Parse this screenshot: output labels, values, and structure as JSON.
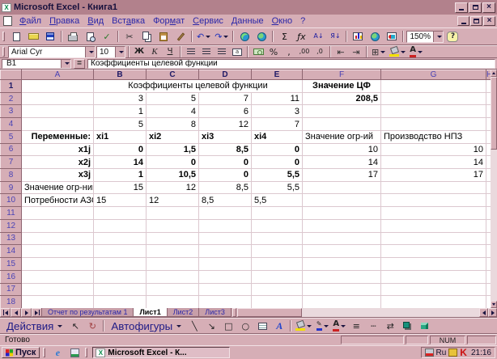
{
  "window": {
    "title": "Microsoft Excel - Книга1",
    "excel_icon_glyph": "X"
  },
  "menu": {
    "items": [
      {
        "name": "file",
        "label": "Файл",
        "u": 0
      },
      {
        "name": "edit",
        "label": "Правка",
        "u": 0
      },
      {
        "name": "view",
        "label": "Вид",
        "u": 0
      },
      {
        "name": "insert",
        "label": "Вставка",
        "u": 3
      },
      {
        "name": "format",
        "label": "Формат",
        "u": 3
      },
      {
        "name": "tools",
        "label": "Сервис",
        "u": 0
      },
      {
        "name": "data",
        "label": "Данные",
        "u": 0
      },
      {
        "name": "window",
        "label": "Окно",
        "u": 0
      },
      {
        "name": "help",
        "label": "?",
        "u": -1
      }
    ]
  },
  "standard_toolbar": {
    "items": [
      {
        "type": "grip"
      },
      {
        "name": "new-document-button",
        "icon": "ic-page"
      },
      {
        "name": "open-button",
        "icon": "ic-folder"
      },
      {
        "name": "save-button",
        "icon": "ic-save"
      },
      {
        "type": "sep"
      },
      {
        "name": "print-button",
        "icon": "ic-printer"
      },
      {
        "name": "print-preview-button",
        "icon": "ic-preview"
      },
      {
        "name": "spelling-button",
        "glyph": "✓",
        "color": "#2a7a2a"
      },
      {
        "type": "sep"
      },
      {
        "name": "cut-button",
        "glyph": "✂",
        "color": "#333333"
      },
      {
        "name": "copy-button",
        "icon": "ic-copy"
      },
      {
        "name": "paste-button",
        "icon": "ic-paste"
      },
      {
        "name": "format-painter-button",
        "icon": "ic-brush"
      },
      {
        "type": "sep"
      },
      {
        "name": "undo-button",
        "glyph": "↶",
        "color": "#2233bb",
        "dropdown": true
      },
      {
        "name": "redo-button",
        "glyph": "↷",
        "color": "#2233bb",
        "dropdown": true
      },
      {
        "type": "sep"
      },
      {
        "name": "insert-hyperlink-button",
        "icon": "ic-globe"
      },
      {
        "name": "web-toolbar-button",
        "icon": "ic-map"
      },
      {
        "type": "sep"
      },
      {
        "name": "autosum-button",
        "glyph": "Σ",
        "color": "#111111"
      },
      {
        "name": "paste-function-button",
        "glyph": "ƒx",
        "cls": "it",
        "color": "#111111"
      },
      {
        "name": "sort-ascending-button",
        "glyph": "А↓",
        "cls": "small",
        "color": "#1a1aa0"
      },
      {
        "name": "sort-descending-button",
        "glyph": "Я↓",
        "cls": "small",
        "color": "#1a1aa0"
      },
      {
        "type": "sep"
      },
      {
        "name": "chart-wizard-button",
        "icon": "ic-chart"
      },
      {
        "name": "map-button",
        "icon": "ic-map"
      },
      {
        "name": "drawing-button",
        "icon": "ic-drawing"
      },
      {
        "type": "sep"
      },
      {
        "type": "combo",
        "name": "zoom-combo",
        "value": "150%",
        "cls": "combo-zoom"
      },
      {
        "name": "help-button",
        "glyph": "?",
        "cls": "help"
      }
    ]
  },
  "formatting_toolbar": {
    "items": [
      {
        "type": "grip"
      },
      {
        "type": "combo",
        "name": "font-name-combo",
        "value": "Arial Cyr",
        "cls": "combo-font"
      },
      {
        "type": "combo",
        "name": "font-size-combo",
        "value": "10",
        "cls": "combo-size"
      },
      {
        "type": "sep"
      },
      {
        "name": "bold-button",
        "glyph": "Ж",
        "cls": "b"
      },
      {
        "name": "italic-button",
        "glyph": "К",
        "cls": "i"
      },
      {
        "name": "underline-button",
        "glyph": "Ч",
        "cls": "u"
      },
      {
        "type": "sep"
      },
      {
        "name": "align-left-button",
        "icon": "ic-align"
      },
      {
        "name": "align-center-button",
        "icon": "ic-align"
      },
      {
        "name": "align-right-button",
        "icon": "ic-align"
      },
      {
        "name": "merge-center-button",
        "glyph": "a",
        "cls": "ic-merge"
      },
      {
        "type": "sep"
      },
      {
        "name": "currency-style-button",
        "icon": "ic-money"
      },
      {
        "name": "percent-style-button",
        "glyph": "%"
      },
      {
        "name": "comma-style-button",
        "glyph": ","
      },
      {
        "name": "increase-decimal-button",
        "glyph": ",00",
        "cls": "small"
      },
      {
        "name": "decrease-decimal-button",
        "glyph": ",0",
        "cls": "small"
      },
      {
        "type": "sep"
      },
      {
        "name": "decrease-indent-button",
        "glyph": "⇤",
        "color": "#333333"
      },
      {
        "name": "increase-indent-button",
        "glyph": "⇥",
        "color": "#333333"
      },
      {
        "type": "sep"
      },
      {
        "name": "borders-button",
        "glyph": "⊞",
        "color": "#333333",
        "dropdown": true
      },
      {
        "name": "fill-color-button",
        "icon": "ic-bucket",
        "bar": "#f2e000",
        "dropdown": true
      },
      {
        "name": "font-color-button",
        "glyph": "А",
        "cls": "b",
        "bar": "#cc2222",
        "dropdown": true
      }
    ]
  },
  "formula_bar": {
    "cell_ref": "B1",
    "equals_label": "=",
    "formula": "Коэффициенты целевой функции"
  },
  "sheet": {
    "columns": [
      "A",
      "B",
      "C",
      "D",
      "E",
      "F",
      "G",
      "H"
    ],
    "selected_columns": [
      "B",
      "C",
      "D",
      "E"
    ],
    "selected_rows": [
      1
    ],
    "row_numbers": [
      1,
      2,
      3,
      4,
      5,
      6,
      7,
      8,
      9,
      10,
      11,
      12,
      13,
      14,
      15,
      16,
      17,
      18
    ],
    "cells": {
      "B1": {
        "v": "Коэффициенты целевой функции",
        "span": 4,
        "al": "c",
        "border": "sel"
      },
      "F1": {
        "v": "Значение ЦФ",
        "bold": 1,
        "al": "c",
        "border": "thin"
      },
      "B2": {
        "v": "3",
        "al": "r",
        "border": "thin"
      },
      "C2": {
        "v": "5",
        "al": "r",
        "border": "thin"
      },
      "D2": {
        "v": "7",
        "al": "r",
        "border": "thin"
      },
      "E2": {
        "v": "11",
        "al": "r",
        "border": "thin"
      },
      "F2": {
        "v": "208,5",
        "bold": 1,
        "al": "r",
        "border": "thick"
      },
      "B3": {
        "v": "1",
        "al": "r",
        "border": "thin"
      },
      "C3": {
        "v": "4",
        "al": "r",
        "border": "thin"
      },
      "D3": {
        "v": "6",
        "al": "r",
        "border": "thin"
      },
      "E3": {
        "v": "3",
        "al": "r",
        "border": "thin"
      },
      "B4": {
        "v": "5",
        "al": "r",
        "border": "thin"
      },
      "C4": {
        "v": "8",
        "al": "r",
        "border": "thin"
      },
      "D4": {
        "v": "12",
        "al": "r",
        "border": "thin"
      },
      "E4": {
        "v": "7",
        "al": "r",
        "border": "thin"
      },
      "A5": {
        "v": "Переменные:",
        "bold": 1,
        "al": "r",
        "border": "thin"
      },
      "B5": {
        "v": "xi1",
        "bold": 1,
        "al": "l",
        "border": "thin"
      },
      "C5": {
        "v": "xi2",
        "bold": 1,
        "al": "l",
        "border": "thin"
      },
      "D5": {
        "v": "xi3",
        "bold": 1,
        "al": "l",
        "border": "thin"
      },
      "E5": {
        "v": "xi4",
        "bold": 1,
        "al": "l",
        "border": "thin"
      },
      "F5": {
        "v": "Значение огр-ий",
        "al": "l",
        "border": "thin"
      },
      "G5": {
        "v": "Производство НПЗ",
        "al": "l",
        "border": "thin"
      },
      "A6": {
        "v": "x1j",
        "bold": 1,
        "al": "r",
        "border": "thin"
      },
      "B6": {
        "v": "0",
        "bold": 1,
        "al": "r",
        "border": "thin"
      },
      "C6": {
        "v": "1,5",
        "bold": 1,
        "al": "r",
        "border": "thin"
      },
      "D6": {
        "v": "8,5",
        "bold": 1,
        "al": "r",
        "border": "thin"
      },
      "E6": {
        "v": "0",
        "bold": 1,
        "al": "r",
        "border": "thin"
      },
      "F6": {
        "v": "10",
        "al": "r",
        "border": "thin"
      },
      "G6": {
        "v": "10",
        "al": "r",
        "border": "thin"
      },
      "A7": {
        "v": "x2j",
        "bold": 1,
        "al": "r",
        "border": "thin"
      },
      "B7": {
        "v": "14",
        "bold": 1,
        "al": "r",
        "border": "thin"
      },
      "C7": {
        "v": "0",
        "bold": 1,
        "al": "r",
        "border": "thin"
      },
      "D7": {
        "v": "0",
        "bold": 1,
        "al": "r",
        "border": "thin"
      },
      "E7": {
        "v": "0",
        "bold": 1,
        "al": "r",
        "border": "thin"
      },
      "F7": {
        "v": "14",
        "al": "r",
        "border": "thin"
      },
      "G7": {
        "v": "14",
        "al": "r",
        "border": "thin"
      },
      "A8": {
        "v": "x3j",
        "bold": 1,
        "al": "r",
        "border": "thin"
      },
      "B8": {
        "v": "1",
        "bold": 1,
        "al": "r",
        "border": "thin"
      },
      "C8": {
        "v": "10,5",
        "bold": 1,
        "al": "r",
        "border": "thin"
      },
      "D8": {
        "v": "0",
        "bold": 1,
        "al": "r",
        "border": "thin"
      },
      "E8": {
        "v": "5,5",
        "bold": 1,
        "al": "r",
        "border": "thin"
      },
      "F8": {
        "v": "17",
        "al": "r",
        "border": "thin"
      },
      "G8": {
        "v": "17",
        "al": "r",
        "border": "thin"
      },
      "A9": {
        "v": "Значение огр-ний",
        "al": "l",
        "border": "thin"
      },
      "B9": {
        "v": "15",
        "al": "r",
        "border": "thin"
      },
      "C9": {
        "v": "12",
        "al": "r",
        "border": "thin"
      },
      "D9": {
        "v": "8,5",
        "al": "r",
        "border": "thin"
      },
      "E9": {
        "v": "5,5",
        "al": "r",
        "border": "thin"
      },
      "A10": {
        "v": "Потребности АЗС",
        "al": "l",
        "border": "thin"
      },
      "B10": {
        "v": "15",
        "al": "l",
        "border": "thin"
      },
      "C10": {
        "v": "12",
        "al": "l",
        "border": "thin"
      },
      "D10": {
        "v": "8,5",
        "al": "l",
        "border": "thin"
      },
      "E10": {
        "v": "5,5",
        "al": "l",
        "border": "thin"
      }
    }
  },
  "sheet_tabs": [
    {
      "name": "tab-report",
      "label": "Отчет по результатам 1",
      "active": false
    },
    {
      "name": "tab-sheet1",
      "label": "Лист1",
      "active": true
    },
    {
      "name": "tab-sheet2",
      "label": "Лист2",
      "active": false
    },
    {
      "name": "tab-sheet3",
      "label": "Лист3",
      "active": false
    }
  ],
  "drawing_toolbar": {
    "items": [
      {
        "type": "label",
        "name": "actions-menu-button",
        "label": "Действия",
        "u": 0,
        "dropdown": true
      },
      {
        "name": "select-objects-button",
        "glyph": "↖",
        "color": "#222222"
      },
      {
        "name": "free-rotate-button",
        "glyph": "↻",
        "color": "#a04040"
      },
      {
        "type": "sep"
      },
      {
        "type": "label",
        "name": "autoshapes-menu-button",
        "label": "Автофигуры",
        "u": 6,
        "dropdown": true
      },
      {
        "name": "line-button",
        "glyph": "╲",
        "color": "#222222"
      },
      {
        "name": "arrow-button",
        "glyph": "↘",
        "color": "#222222"
      },
      {
        "name": "rectangle-button",
        "glyph": "□",
        "color": "#222222"
      },
      {
        "name": "oval-button",
        "glyph": "○",
        "color": "#222222"
      },
      {
        "name": "text-box-button",
        "icon": "ic-textbox"
      },
      {
        "name": "wordart-button",
        "glyph": "A",
        "cls": "wordart"
      },
      {
        "type": "sep"
      },
      {
        "name": "fill-color-button",
        "icon": "ic-bucket",
        "bar": "#f2e000",
        "dropdown": true
      },
      {
        "name": "line-color-button",
        "glyph": "✎",
        "cls": "small",
        "bar": "#2233cc",
        "dropdown": true
      },
      {
        "name": "font-color-button",
        "glyph": "А",
        "cls": "b",
        "bar": "#cc2222",
        "dropdown": true
      },
      {
        "name": "line-style-button",
        "glyph": "≡",
        "color": "#222222"
      },
      {
        "name": "dash-style-button",
        "glyph": "┄",
        "color": "#222222"
      },
      {
        "name": "arrow-style-button",
        "glyph": "⇄",
        "color": "#222222"
      },
      {
        "name": "shadow-button",
        "icon": "ic-shadow"
      },
      {
        "name": "3d-button",
        "icon": "ic-cube"
      }
    ]
  },
  "status_bar": {
    "mode": "Готово",
    "panels": [
      "",
      "",
      "NUM",
      ""
    ]
  },
  "taskbar": {
    "start_label": "Пуск",
    "task_label": "Microsoft Excel - К...",
    "tray": {
      "lang": "Ru",
      "antivirus_glyph": "K",
      "clock": "21:16"
    }
  }
}
